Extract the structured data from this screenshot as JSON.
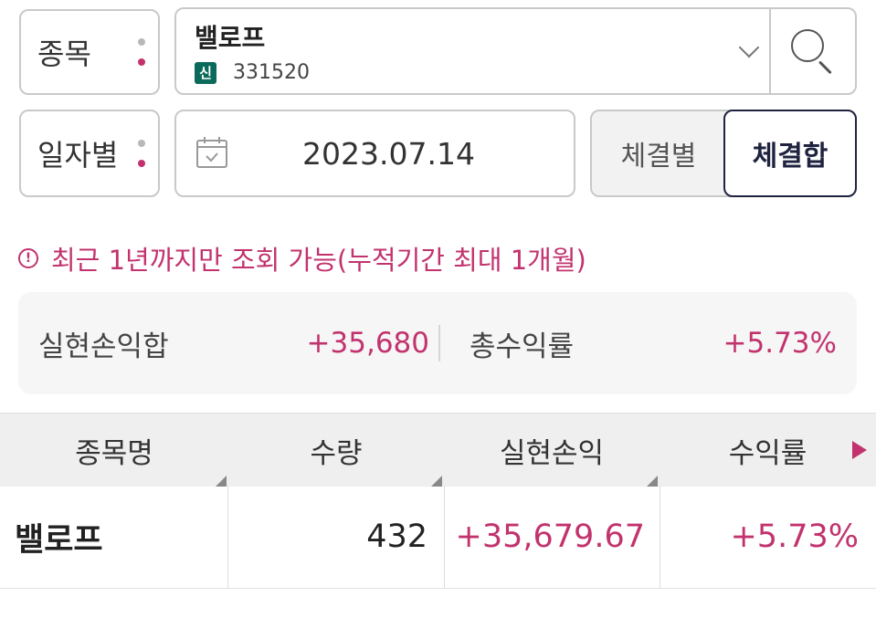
{
  "search": {
    "label": "종목",
    "stock_name": "밸로프",
    "badge": "신",
    "code": "331520"
  },
  "date_filter": {
    "label": "일자별",
    "date": "2023.07.14"
  },
  "toggle": {
    "left": "체결별",
    "right": "체결합",
    "selected": "체결합"
  },
  "notice": {
    "icon": "!",
    "text": "최근 1년까지만 조회 가능(누적기간 최대 1개월)"
  },
  "summary": {
    "realized_label": "실현손익합",
    "realized_value": "+35,680",
    "return_label": "총수익률",
    "return_value": "+5.73%"
  },
  "table": {
    "headers": [
      "종목명",
      "수량",
      "실현손익",
      "수익률"
    ],
    "rows": [
      {
        "name": "밸로프",
        "qty": "432",
        "profit": "+35,679.67",
        "rate": "+5.73%"
      }
    ]
  },
  "colors": {
    "accent": "#c2336e",
    "selected_border": "#1f2340",
    "badge": "#0b6b5a"
  }
}
